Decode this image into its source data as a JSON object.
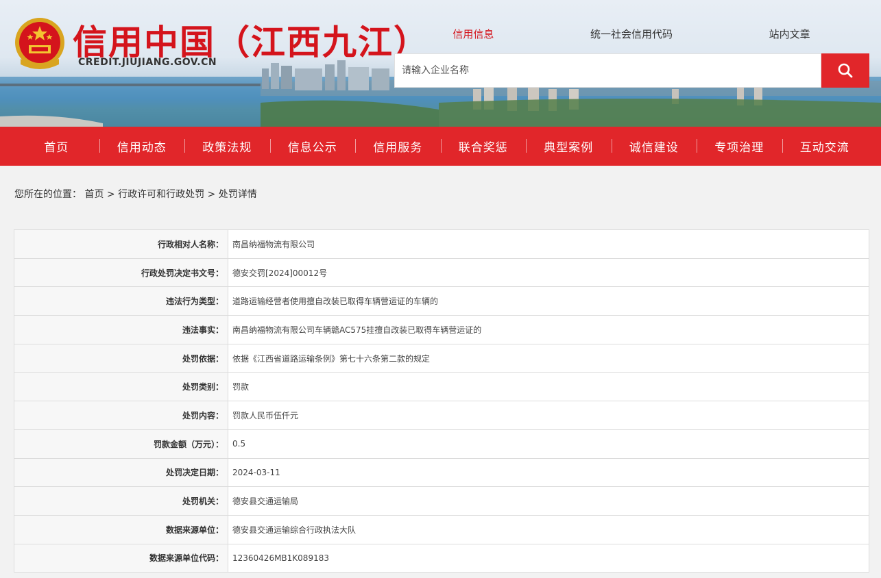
{
  "header": {
    "site_title": "信用中国（江西九江）",
    "site_domain": "CREDIT.JIUJIANG.GOV.CN",
    "search_tabs": [
      {
        "label": "信用信息",
        "active": true
      },
      {
        "label": "统一社会信用代码",
        "active": false
      },
      {
        "label": "站内文章",
        "active": false
      }
    ],
    "search_placeholder": "请输入企业名称",
    "accent_color": "#e1262a"
  },
  "nav": {
    "items": [
      "首页",
      "信用动态",
      "政策法规",
      "信息公示",
      "信用服务",
      "联合奖惩",
      "典型案例",
      "诚信建设",
      "专项治理",
      "互动交流"
    ]
  },
  "breadcrumb": {
    "prefix": "您所在的位置：",
    "items": [
      "首页",
      "行政许可和行政处罚",
      "处罚详情"
    ],
    "separator": " > "
  },
  "details": [
    {
      "label": "行政相对人名称：",
      "value": "南昌纳福物流有限公司"
    },
    {
      "label": "行政处罚决定书文号：",
      "value": "德安交罚[2024]00012号"
    },
    {
      "label": "违法行为类型：",
      "value": "道路运输经营者使用擅自改装已取得车辆营运证的车辆的"
    },
    {
      "label": "违法事实：",
      "value": "南昌纳福物流有限公司车辆赣AC575挂擅自改装已取得车辆营运证的"
    },
    {
      "label": "处罚依据：",
      "value": "依据《江西省道路运输条例》第七十六条第二款的规定"
    },
    {
      "label": "处罚类别：",
      "value": "罚款"
    },
    {
      "label": "处罚内容：",
      "value": "罚款人民币伍仟元"
    },
    {
      "label": "罚款金额（万元）：",
      "value": "0.5"
    },
    {
      "label": "处罚决定日期：",
      "value": "2024-03-11"
    },
    {
      "label": "处罚机关：",
      "value": "德安县交通运输局"
    },
    {
      "label": "数据来源单位：",
      "value": "德安县交通运输综合行政执法大队"
    },
    {
      "label": "数据来源单位代码：",
      "value": "12360426MB1K089183"
    }
  ]
}
